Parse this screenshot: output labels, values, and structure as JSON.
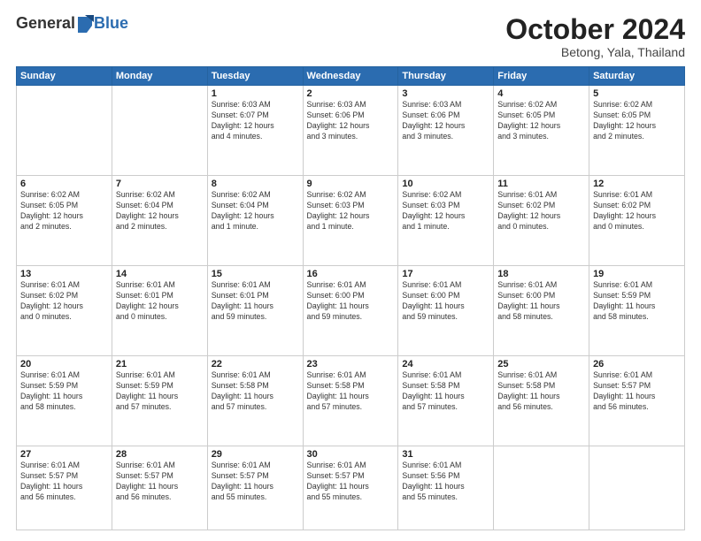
{
  "logo": {
    "general": "General",
    "blue": "Blue"
  },
  "header": {
    "month": "October 2024",
    "location": "Betong, Yala, Thailand"
  },
  "weekdays": [
    "Sunday",
    "Monday",
    "Tuesday",
    "Wednesday",
    "Thursday",
    "Friday",
    "Saturday"
  ],
  "weeks": [
    [
      {
        "day": "",
        "info": ""
      },
      {
        "day": "",
        "info": ""
      },
      {
        "day": "1",
        "info": "Sunrise: 6:03 AM\nSunset: 6:07 PM\nDaylight: 12 hours\nand 4 minutes."
      },
      {
        "day": "2",
        "info": "Sunrise: 6:03 AM\nSunset: 6:06 PM\nDaylight: 12 hours\nand 3 minutes."
      },
      {
        "day": "3",
        "info": "Sunrise: 6:03 AM\nSunset: 6:06 PM\nDaylight: 12 hours\nand 3 minutes."
      },
      {
        "day": "4",
        "info": "Sunrise: 6:02 AM\nSunset: 6:05 PM\nDaylight: 12 hours\nand 3 minutes."
      },
      {
        "day": "5",
        "info": "Sunrise: 6:02 AM\nSunset: 6:05 PM\nDaylight: 12 hours\nand 2 minutes."
      }
    ],
    [
      {
        "day": "6",
        "info": "Sunrise: 6:02 AM\nSunset: 6:05 PM\nDaylight: 12 hours\nand 2 minutes."
      },
      {
        "day": "7",
        "info": "Sunrise: 6:02 AM\nSunset: 6:04 PM\nDaylight: 12 hours\nand 2 minutes."
      },
      {
        "day": "8",
        "info": "Sunrise: 6:02 AM\nSunset: 6:04 PM\nDaylight: 12 hours\nand 1 minute."
      },
      {
        "day": "9",
        "info": "Sunrise: 6:02 AM\nSunset: 6:03 PM\nDaylight: 12 hours\nand 1 minute."
      },
      {
        "day": "10",
        "info": "Sunrise: 6:02 AM\nSunset: 6:03 PM\nDaylight: 12 hours\nand 1 minute."
      },
      {
        "day": "11",
        "info": "Sunrise: 6:01 AM\nSunset: 6:02 PM\nDaylight: 12 hours\nand 0 minutes."
      },
      {
        "day": "12",
        "info": "Sunrise: 6:01 AM\nSunset: 6:02 PM\nDaylight: 12 hours\nand 0 minutes."
      }
    ],
    [
      {
        "day": "13",
        "info": "Sunrise: 6:01 AM\nSunset: 6:02 PM\nDaylight: 12 hours\nand 0 minutes."
      },
      {
        "day": "14",
        "info": "Sunrise: 6:01 AM\nSunset: 6:01 PM\nDaylight: 12 hours\nand 0 minutes."
      },
      {
        "day": "15",
        "info": "Sunrise: 6:01 AM\nSunset: 6:01 PM\nDaylight: 11 hours\nand 59 minutes."
      },
      {
        "day": "16",
        "info": "Sunrise: 6:01 AM\nSunset: 6:00 PM\nDaylight: 11 hours\nand 59 minutes."
      },
      {
        "day": "17",
        "info": "Sunrise: 6:01 AM\nSunset: 6:00 PM\nDaylight: 11 hours\nand 59 minutes."
      },
      {
        "day": "18",
        "info": "Sunrise: 6:01 AM\nSunset: 6:00 PM\nDaylight: 11 hours\nand 58 minutes."
      },
      {
        "day": "19",
        "info": "Sunrise: 6:01 AM\nSunset: 5:59 PM\nDaylight: 11 hours\nand 58 minutes."
      }
    ],
    [
      {
        "day": "20",
        "info": "Sunrise: 6:01 AM\nSunset: 5:59 PM\nDaylight: 11 hours\nand 58 minutes."
      },
      {
        "day": "21",
        "info": "Sunrise: 6:01 AM\nSunset: 5:59 PM\nDaylight: 11 hours\nand 57 minutes."
      },
      {
        "day": "22",
        "info": "Sunrise: 6:01 AM\nSunset: 5:58 PM\nDaylight: 11 hours\nand 57 minutes."
      },
      {
        "day": "23",
        "info": "Sunrise: 6:01 AM\nSunset: 5:58 PM\nDaylight: 11 hours\nand 57 minutes."
      },
      {
        "day": "24",
        "info": "Sunrise: 6:01 AM\nSunset: 5:58 PM\nDaylight: 11 hours\nand 57 minutes."
      },
      {
        "day": "25",
        "info": "Sunrise: 6:01 AM\nSunset: 5:58 PM\nDaylight: 11 hours\nand 56 minutes."
      },
      {
        "day": "26",
        "info": "Sunrise: 6:01 AM\nSunset: 5:57 PM\nDaylight: 11 hours\nand 56 minutes."
      }
    ],
    [
      {
        "day": "27",
        "info": "Sunrise: 6:01 AM\nSunset: 5:57 PM\nDaylight: 11 hours\nand 56 minutes."
      },
      {
        "day": "28",
        "info": "Sunrise: 6:01 AM\nSunset: 5:57 PM\nDaylight: 11 hours\nand 56 minutes."
      },
      {
        "day": "29",
        "info": "Sunrise: 6:01 AM\nSunset: 5:57 PM\nDaylight: 11 hours\nand 55 minutes."
      },
      {
        "day": "30",
        "info": "Sunrise: 6:01 AM\nSunset: 5:57 PM\nDaylight: 11 hours\nand 55 minutes."
      },
      {
        "day": "31",
        "info": "Sunrise: 6:01 AM\nSunset: 5:56 PM\nDaylight: 11 hours\nand 55 minutes."
      },
      {
        "day": "",
        "info": ""
      },
      {
        "day": "",
        "info": ""
      }
    ]
  ]
}
